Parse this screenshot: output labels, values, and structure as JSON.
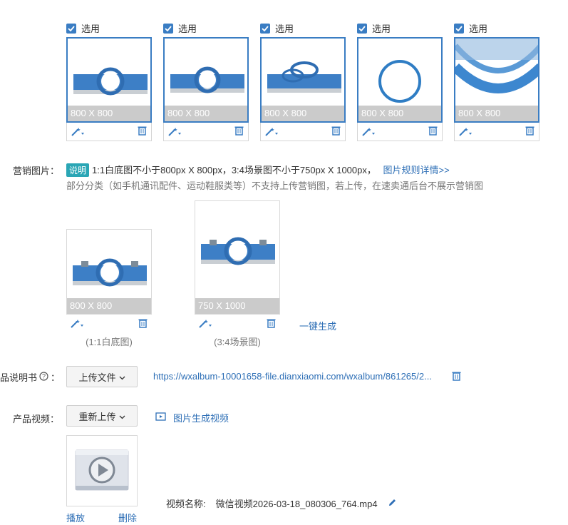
{
  "images": {
    "select_label": "选用",
    "cards": [
      {
        "size": "800 X 800"
      },
      {
        "size": "800 X 800"
      },
      {
        "size": "800 X 800"
      },
      {
        "size": "800 X 800"
      },
      {
        "size": "800 X 800"
      }
    ]
  },
  "marketing": {
    "label": "营销图片：",
    "badge": "说明",
    "rule_text": "1:1白底图不小于800px X 800px，3:4场景图不小于750px X 1000px，",
    "rule_link": "图片规则详情>>",
    "note": "部分分类（如手机通讯配件、运动鞋服类等）不支持上传营销图，若上传，在速卖通后台不展示营销图",
    "square": {
      "size": "800 X 800",
      "caption": "(1:1白底图)"
    },
    "portrait": {
      "size": "750 X 1000",
      "caption": "(3:4场景图)"
    },
    "generate": "一键生成"
  },
  "manual": {
    "label": "品说明书",
    "upload_button": "上传文件",
    "url": "https://wxalbum-10001658-file.dianxiaomi.com/wxalbum/861265/2..."
  },
  "video": {
    "label": "产品视频：",
    "reupload_button": "重新上传",
    "generate_link": "图片生成视频",
    "name_label": "视频名称:",
    "name_value": "微信视频2026-03-18_080306_764.mp4",
    "play": "播放",
    "delete": "删除"
  },
  "colors": {
    "accent": "#3a7dc3",
    "link": "#2e6fb6",
    "badge": "#2aa6b5"
  }
}
